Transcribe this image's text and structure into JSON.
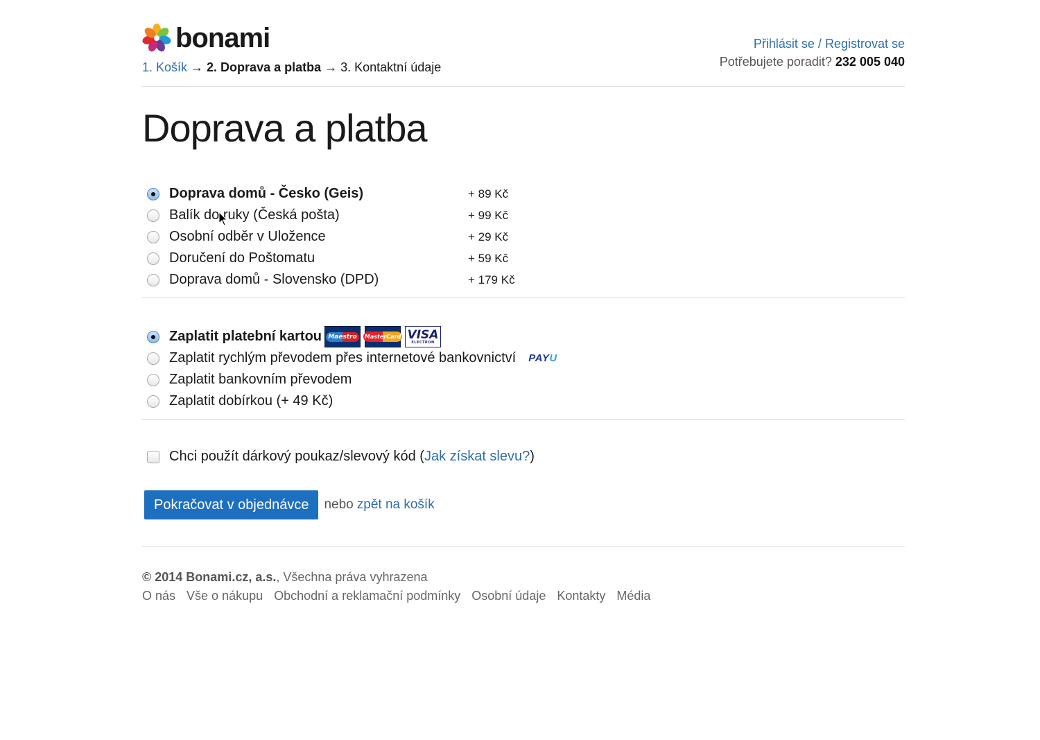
{
  "brand": {
    "logo_text": "bonami"
  },
  "steps": {
    "step1": "1. Košík",
    "arrow1": " → ",
    "step2": "2. Doprava a platba",
    "arrow2": " → ",
    "step3": "3. Kontaktní údaje"
  },
  "header": {
    "login": "Přihlásit se",
    "separator": " / ",
    "register": "Registrovat se",
    "help_text": "Potřebujete poradit? ",
    "phone": "232 005 040"
  },
  "page_title": "Doprava a platba",
  "shipping": [
    {
      "label": "Doprava domů - Česko (Geis)",
      "price": "+ 89 Kč",
      "selected": true
    },
    {
      "label": "Balík do ruky (Česká pošta)",
      "price": "+ 99 Kč",
      "selected": false
    },
    {
      "label": "Osobní odběr v Uložence",
      "price": "+ 29 Kč",
      "selected": false
    },
    {
      "label": "Doručení do Poštomatu",
      "price": "+ 59 Kč",
      "selected": false
    },
    {
      "label": "Doprava domů - Slovensko (DPD)",
      "price": "+ 179 Kč",
      "selected": false
    }
  ],
  "payment": [
    {
      "label": "Zaplatit platební kartou",
      "selected": true
    },
    {
      "label": "Zaplatit rychlým převodem přes internetové bankovnictví",
      "selected": false
    },
    {
      "label": "Zaplatit bankovním převodem",
      "selected": false
    },
    {
      "label": "Zaplatit dobírkou (+ 49 Kč)",
      "selected": false
    }
  ],
  "card_logos": {
    "maestro": "Maestro",
    "mastercard": "MasterCard",
    "visa": "VISA",
    "visa_sub": "ELECTRON"
  },
  "payu": {
    "pa": "PAY",
    "u": "U"
  },
  "voucher": {
    "text": "Chci použít dárkový poukaz/slevový kód (",
    "link": "Jak získat slevu?",
    "close": ")",
    "checked": false
  },
  "actions": {
    "continue": "Pokračovat v objednávce",
    "or": "nebo",
    "back": "zpět na košík"
  },
  "footer": {
    "copyright": "© 2014 Bonami.cz, a.s.",
    "rights": ", Všechna práva vyhrazena",
    "links": [
      "O nás",
      "Vše o nákupu",
      "Obchodní a reklamační podmínky",
      "Osobní údaje",
      "Kontakty",
      "Média"
    ]
  }
}
